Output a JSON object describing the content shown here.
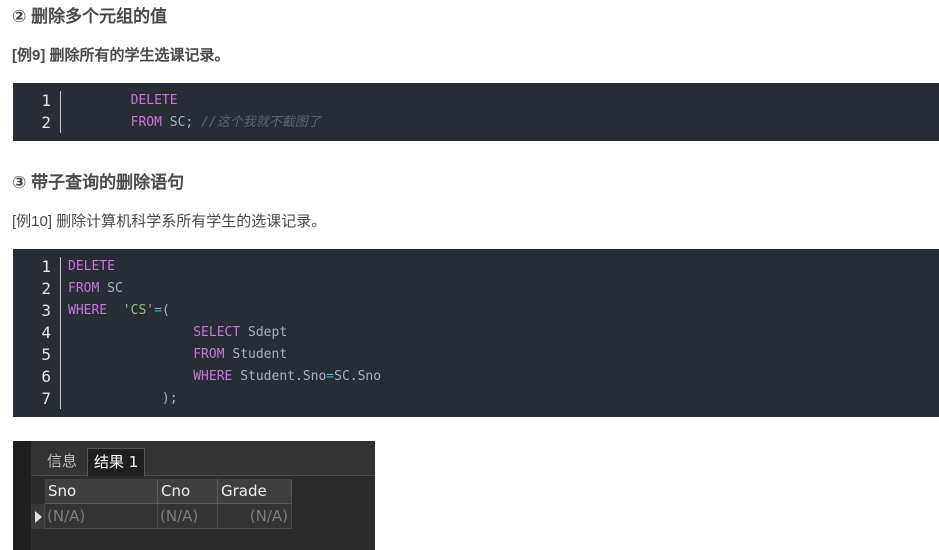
{
  "sections": [
    {
      "heading": "② 删除多个元组的值",
      "example": "[例9] 删除所有的学生选课记录。"
    },
    {
      "heading": "③ 带子查询的删除语句",
      "example": "[例10] 删除计算机科学系所有学生的选课记录。"
    }
  ],
  "code1": {
    "line_numbers": [
      "1",
      "2"
    ],
    "lines": [
      {
        "indent": "        ",
        "kw": "DELETE",
        "rest": "",
        "comment": ""
      },
      {
        "indent": "        ",
        "kw": "FROM",
        "rest": " SC;",
        "comment": "//这个我就不截图了"
      }
    ]
  },
  "code2": {
    "line_numbers": [
      "1",
      "2",
      "3",
      "4",
      "5",
      "6",
      "7"
    ],
    "l1": {
      "kw": "DELETE"
    },
    "l2": {
      "kw": "FROM",
      "rest": " SC"
    },
    "l3": {
      "kw": "WHERE",
      "str": "'CS'",
      "op": "=",
      "rest": "("
    },
    "l4": {
      "indent": "                ",
      "kw": "SELECT",
      "rest": " Sdept"
    },
    "l5": {
      "indent": "                ",
      "kw": "FROM",
      "rest": " Student"
    },
    "l6": {
      "indent": "                ",
      "kw": "WHERE",
      "rest1": " Student.Sno",
      "op": "=",
      "rest2": "SC.Sno"
    },
    "l7": {
      "indent": "            ",
      "rest": ");"
    }
  },
  "result_panel": {
    "tabs": [
      "信息",
      "结果 1"
    ],
    "active_tab": "结果 1",
    "columns": [
      "Sno",
      "Cno",
      "Grade"
    ],
    "rows": [
      [
        "(N/A)",
        "(N/A)",
        "(N/A)"
      ]
    ]
  }
}
